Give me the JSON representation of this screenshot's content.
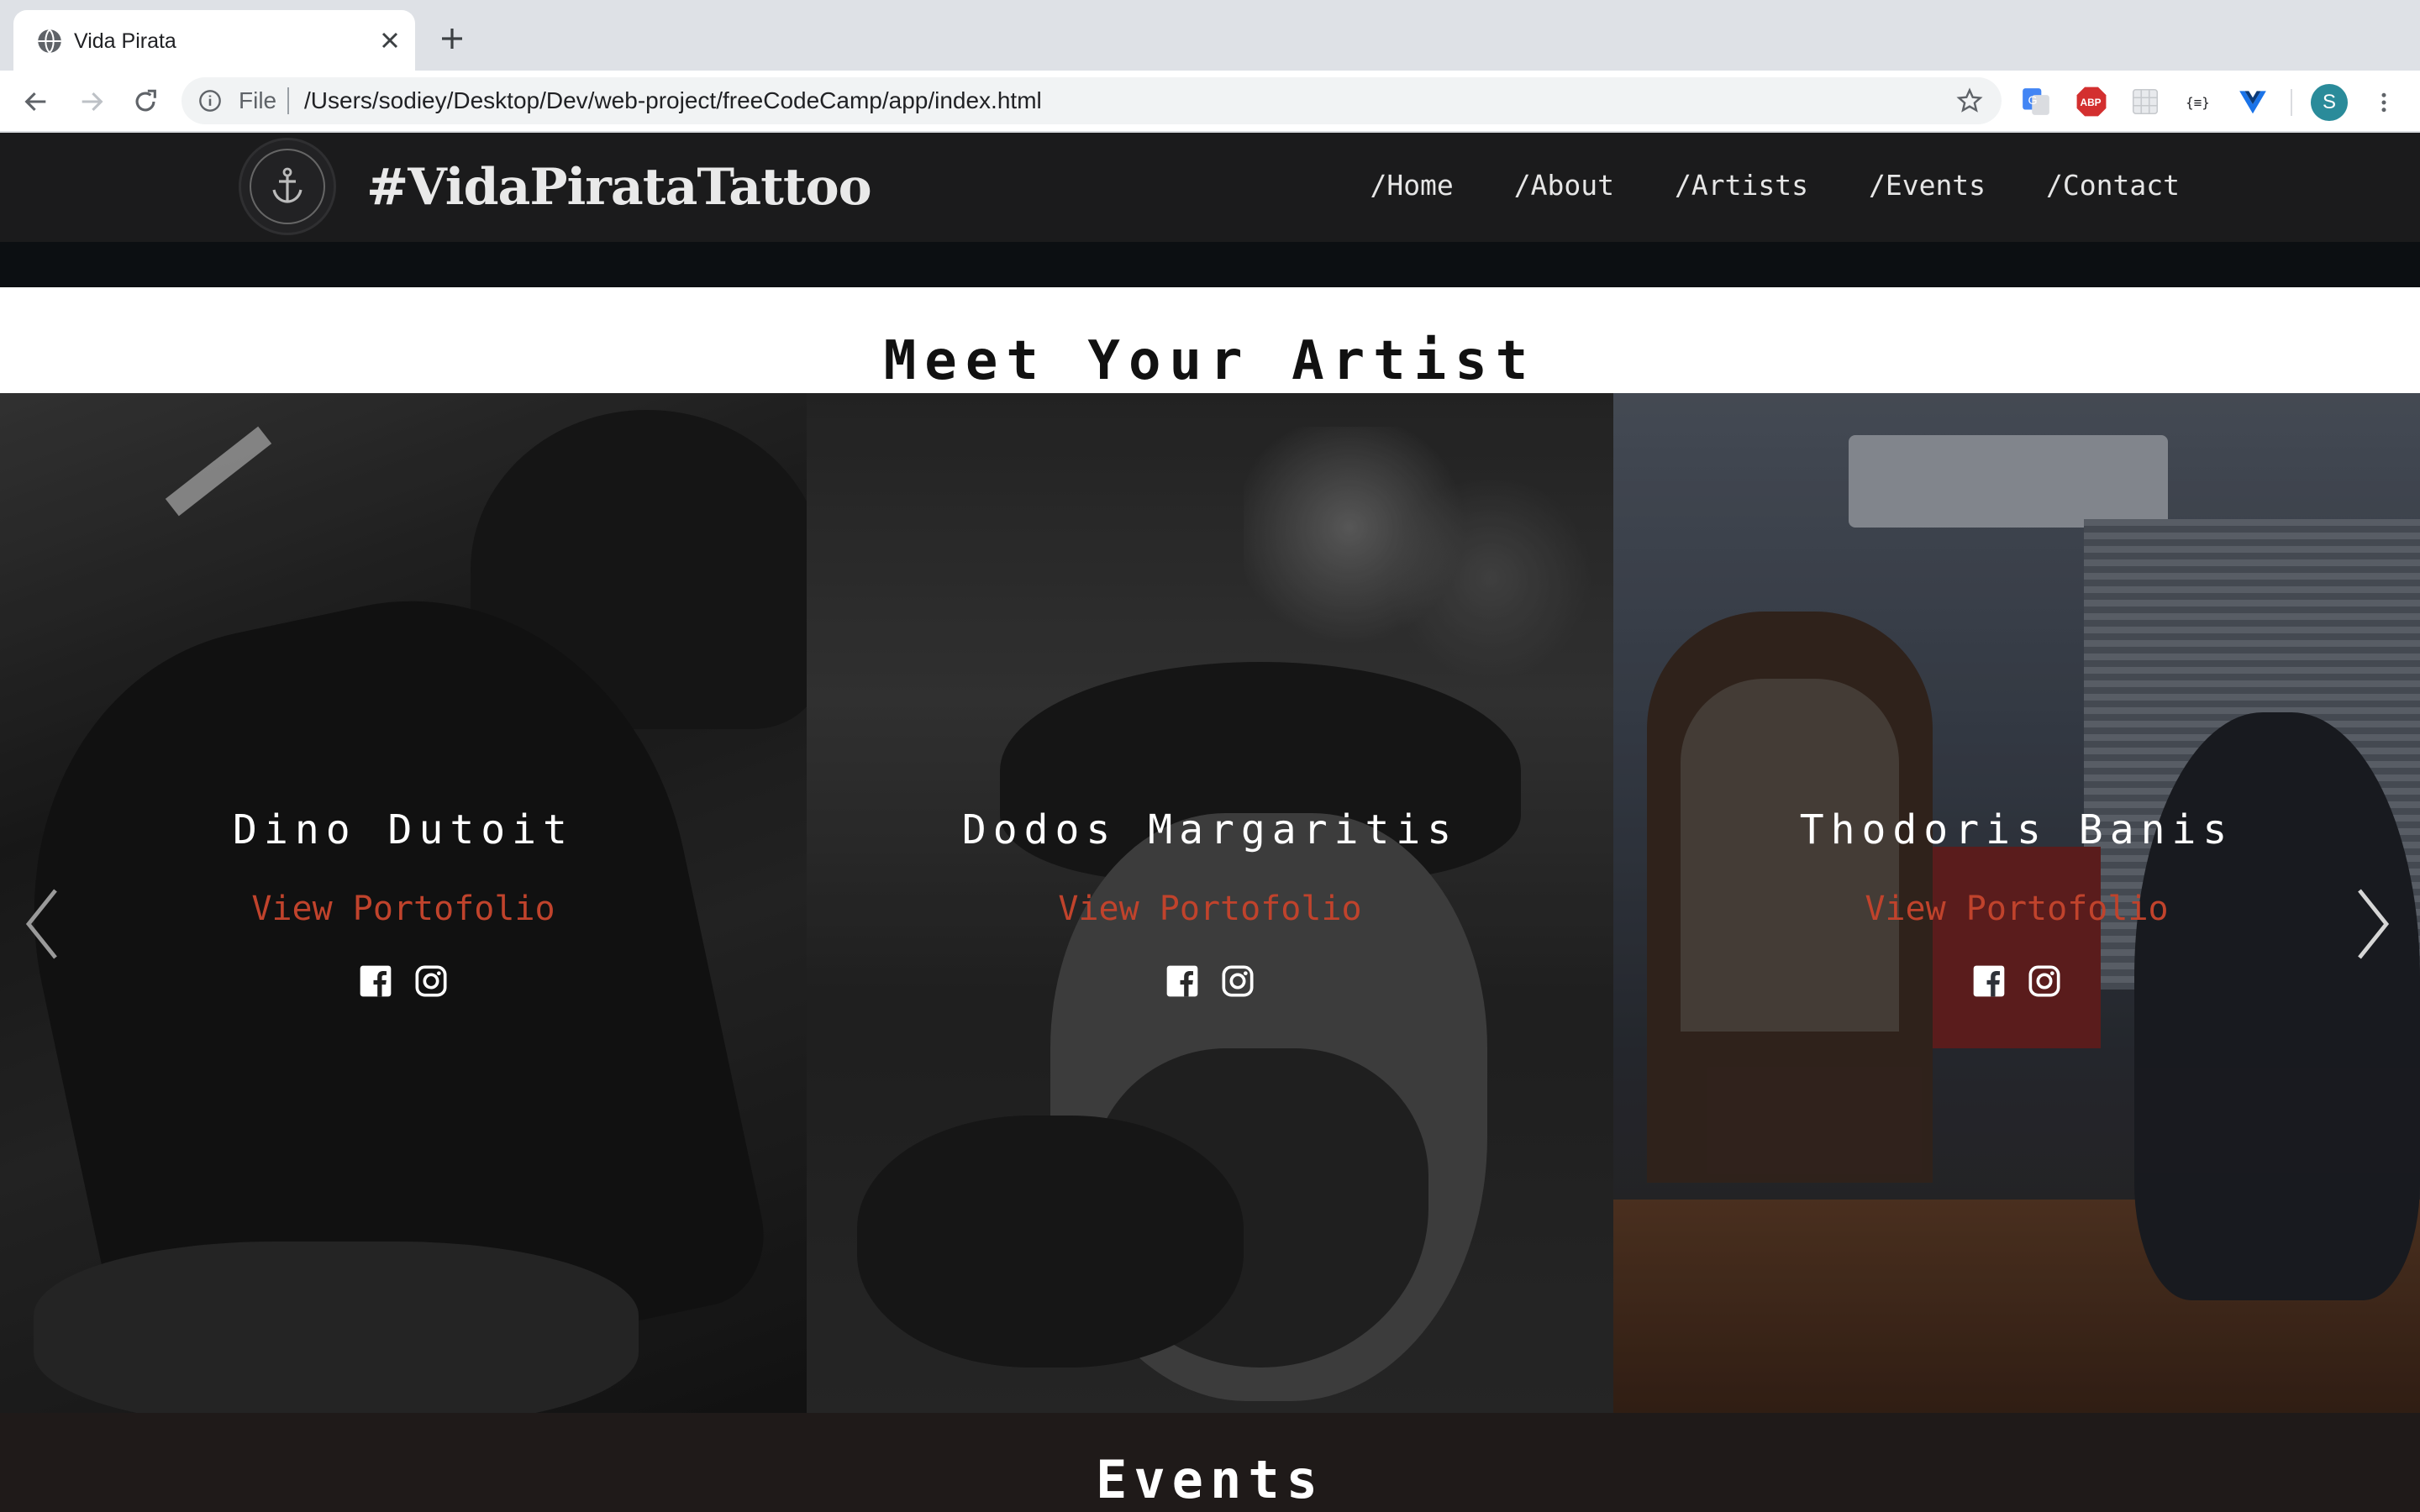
{
  "browser": {
    "tab_title": "Vida Pirata",
    "file_label": "File",
    "url": "/Users/sodiey/Desktop/Dev/web-project/freeCodeCamp/app/index.html",
    "profile_initial": "S",
    "extensions": [
      "google-translate-icon",
      "adblock-plus-icon",
      "extension-grid-icon",
      "json-viewer-icon",
      "vue-devtools-icon"
    ]
  },
  "header": {
    "brand": "#VidaPirataTattoo",
    "nav": [
      "/Home",
      "/About",
      "/Artists",
      "/Events",
      "/Contact"
    ]
  },
  "artists_section": {
    "title": "Meet Your Artist",
    "artists": [
      {
        "name": "Dino Dutoit",
        "portfolio_label": "View Portofolio"
      },
      {
        "name": "Dodos Margaritis",
        "portfolio_label": "View Portofolio"
      },
      {
        "name": "Thodoris Banis",
        "portfolio_label": "View Portofolio"
      }
    ]
  },
  "events_section": {
    "title": "Events"
  },
  "colors": {
    "accent_link": "#c0432c",
    "header_bg": "#1b1b1c",
    "events_bg": "#1f1a19"
  }
}
